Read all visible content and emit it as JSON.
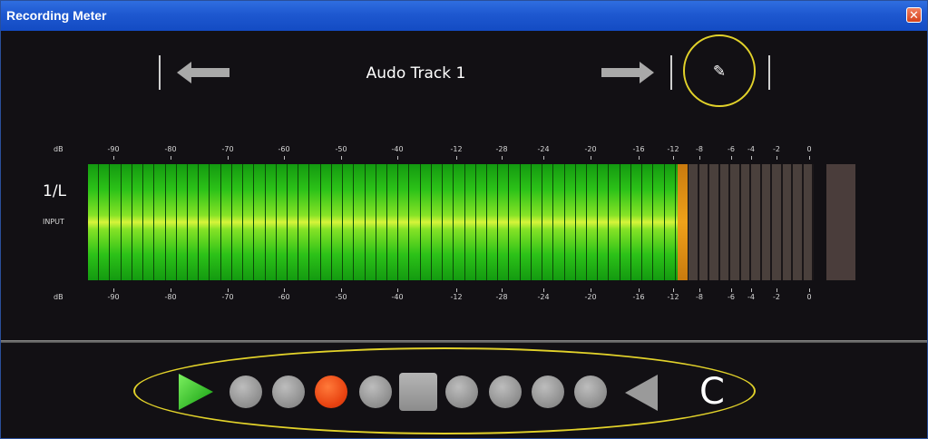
{
  "window": {
    "title": "Recording Meter",
    "close_glyph": "✕"
  },
  "track": {
    "name": "Audo Track 1"
  },
  "icons": {
    "prev": "arrow-left-icon",
    "next": "arrow-right-icon",
    "settings": "wrench-icon",
    "play": "play-icon",
    "rewind": "triangle-left-icon"
  },
  "settings_glyph": "✎",
  "meter": {
    "unit_label": "dB",
    "channel": "1/L",
    "input_label": "INPUT",
    "scale": [
      "-90",
      "-80",
      "-70",
      "-60",
      "-50",
      "-40",
      "-12",
      "-28",
      "-24",
      "-20",
      "-16",
      "-12",
      "-8",
      "-6",
      "-4",
      "-2",
      "0"
    ],
    "lit_fraction": 0.825,
    "colors": {
      "lit": "#2cc218",
      "peak": "#f0a21a",
      "unlit": "#4a403c",
      "clip": "#4a3d3b"
    }
  },
  "transport": {
    "c_label": "C",
    "record_color": "#e84210",
    "play_color": "#22c61a"
  }
}
